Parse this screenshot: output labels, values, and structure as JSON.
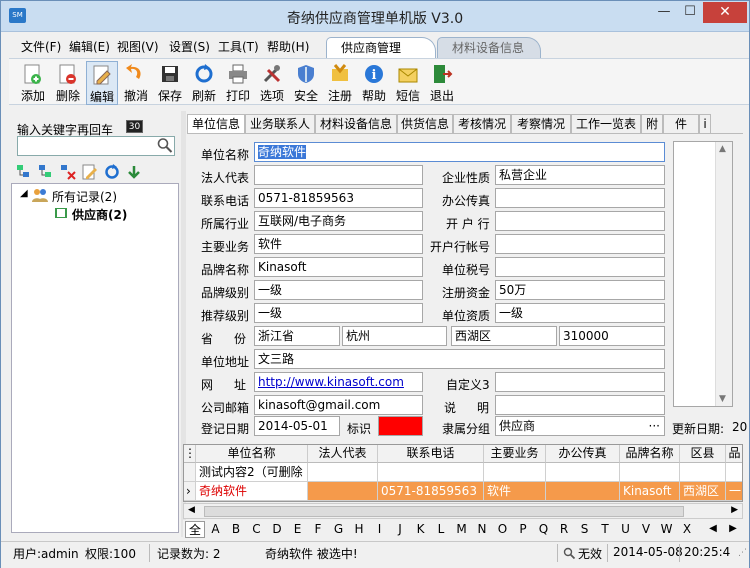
{
  "window": {
    "title": "奇纳供应商管理单机版 V3.0",
    "minimize": "—",
    "maximize": "☐",
    "close": "✕"
  },
  "menu": [
    "文件(F)",
    "编辑(E)",
    "视图(V)",
    "设置(S)",
    "工具(T)",
    "帮助(H)"
  ],
  "top_tabs": [
    "供应商管理",
    "材料设备信息"
  ],
  "toolbar": [
    "添加",
    "删除",
    "编辑",
    "撤消",
    "保存",
    "刷新",
    "打印",
    "选项",
    "安全",
    "注册",
    "帮助",
    "短信",
    "退出"
  ],
  "left": {
    "keyword_label": "输入关键字再回车",
    "keyword_badge": "30",
    "keyword_value": "",
    "tree_root": "所有记录(2)",
    "tree_child": "供应商(2)"
  },
  "right_tabs": [
    "单位信息",
    "业务联系人",
    "材料设备信息",
    "供货信息",
    "考核情况",
    "考察情况",
    "工作一览表",
    "附",
    "件",
    "i"
  ],
  "form": {
    "labels": {
      "name": "单位名称",
      "legal": "法人代表",
      "nature": "企业性质",
      "phone": "联系电话",
      "fax": "办公传真",
      "industry": "所属行业",
      "bank": "开 户 行",
      "business": "主要业务",
      "account": "开户行帐号",
      "brand": "品牌名称",
      "taxno": "单位税号",
      "brandlevel": "品牌级别",
      "capital": "注册资金",
      "recommend": "推荐级别",
      "qualification": "单位资质",
      "province_a": "省",
      "province_b": "份",
      "address": "单位地址",
      "web_a": "网",
      "web_b": "址",
      "custom3": "自定义3",
      "email": "公司邮箱",
      "desc_a": "说",
      "desc_b": "明",
      "regdate": "登记日期",
      "mark": "标识",
      "group": "隶属分组",
      "update": "更新日期:"
    },
    "values": {
      "name": "奇纳软件",
      "legal": "",
      "nature": "私营企业",
      "phone": "0571-81859563",
      "fax": "",
      "industry": "互联网/电子商务",
      "bank": "",
      "business": "软件",
      "account": "",
      "brand": "Kinasoft",
      "taxno": "",
      "brandlevel": "一级",
      "capital": "50万",
      "recommend": "一级",
      "qualification": "一级",
      "province": "浙江省",
      "city": "杭州",
      "district": "西湖区",
      "zip": "310000",
      "address": "文三路",
      "web": "http://www.kinasoft.com",
      "custom3": "",
      "email": "kinasoft@gmail.com",
      "desc": "",
      "regdate": "2014-05-01",
      "group": "供应商",
      "update": "20",
      "ellipsis": "···"
    },
    "mark_color": "#ff0000"
  },
  "grid": {
    "headers": [
      "单位名称",
      "法人代表",
      "联系电话",
      "主要业务",
      "办公传真",
      "品牌名称",
      "区县",
      "品"
    ],
    "rows": [
      [
        "测试内容2（可删除",
        "",
        "",
        "",
        "",
        "",
        "",
        ""
      ],
      [
        "奇纳软件",
        "",
        "0571-81859563",
        "软件",
        "",
        "Kinasoft",
        "西湖区",
        "一"
      ]
    ],
    "selected_row_color": "#f59a4b",
    "row_pointer": "›"
  },
  "letters": [
    "全",
    "A",
    "B",
    "C",
    "D",
    "E",
    "F",
    "G",
    "H",
    "I",
    "J",
    "K",
    "L",
    "M",
    "N",
    "O",
    "P",
    "Q",
    "R",
    "S",
    "T",
    "U",
    "V",
    "W",
    "X"
  ],
  "status": {
    "user": "用户:admin",
    "permission": "权限:100",
    "count": "记录数为: 2",
    "selected": "奇纳软件 被选中!",
    "search": "无效",
    "date": "2014-05-08",
    "time": "20:25:4"
  },
  "colors": {
    "accent": "#2a78c8",
    "selected_row": "#f59a4b",
    "mark": "#ff0000",
    "link": "#0000cc"
  }
}
